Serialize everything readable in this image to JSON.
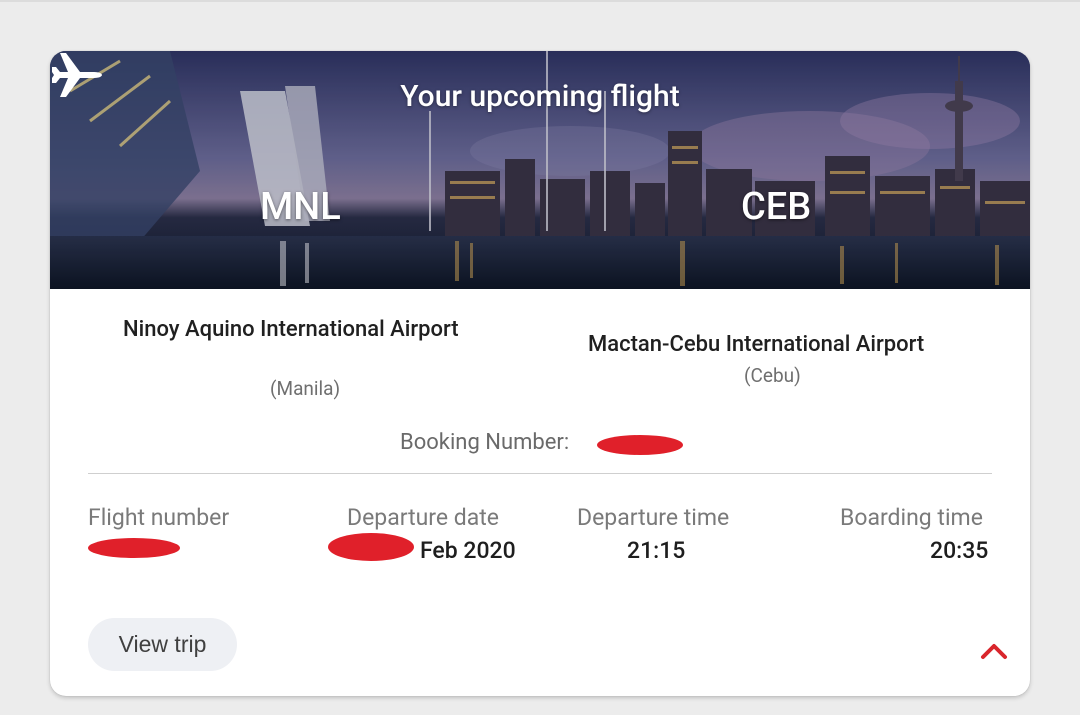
{
  "card": {
    "hero_title": "Your upcoming flight",
    "origin_code": "MNL",
    "destination_code": "CEB",
    "plane_icon": "airplane-icon"
  },
  "origin": {
    "airport": "Ninoy Aquino International Airport",
    "city": "(Manila)"
  },
  "destination": {
    "airport": "Mactan-Cebu International Airport",
    "city": "(Cebu)"
  },
  "booking": {
    "label": "Booking Number:"
  },
  "details": {
    "flight_number_label": "Flight number",
    "departure_date_label": "Departure date",
    "departure_date_value": "Feb 2020",
    "departure_time_label": "Departure time",
    "departure_time_value": "21:15",
    "boarding_time_label": "Boarding time",
    "boarding_time_value": "20:35"
  },
  "actions": {
    "view_trip": "View trip",
    "collapse_icon": "chevron-up-icon"
  },
  "colors": {
    "accent": "#d9262c",
    "redaction": "#e0202a",
    "button_bg": "#eef0f4"
  }
}
